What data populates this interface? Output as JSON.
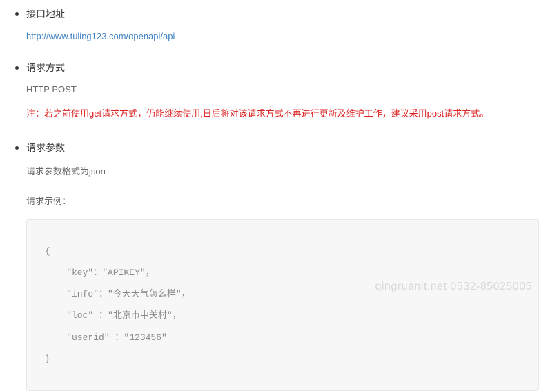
{
  "sections": {
    "endpoint": {
      "title": "接口地址",
      "url": "http://www.tuling123.com/openapi/api"
    },
    "method": {
      "title": "请求方式",
      "value": "HTTP POST",
      "note": "注：若之前使用get请求方式，仍能继续使用,日后将对该请求方式不再进行更新及维护工作，建议采用post请求方式。"
    },
    "params": {
      "title": "请求参数",
      "format_text": "请求参数格式为json",
      "example_label": "请求示例：",
      "code_lines": [
        "{",
        "    \"key\"：\"APIKEY\"，",
        "    \"info\"：\"今天天气怎么样\"，",
        "    \"loc\" ：\"北京市中关村\"，",
        "    \"userid\" ：\"123456\"",
        "}"
      ]
    }
  },
  "watermark": "qingruanit.net 0532-85025005"
}
